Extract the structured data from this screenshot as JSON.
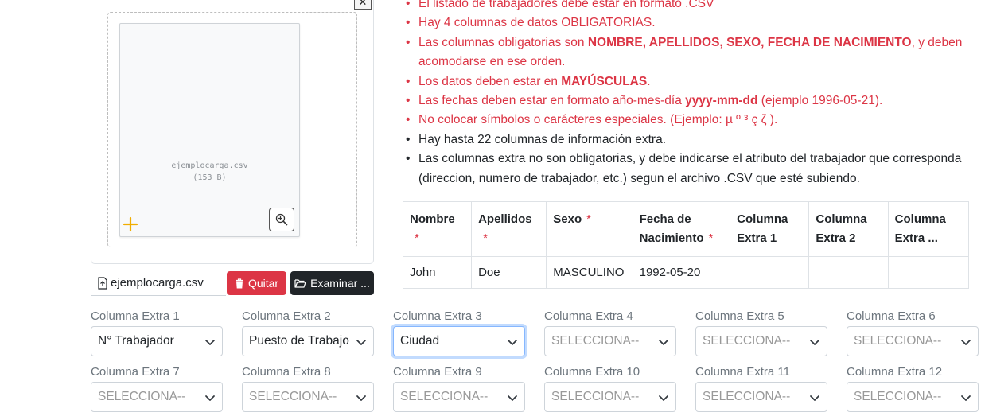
{
  "upload": {
    "close_label": "✕",
    "file_name": "ejemplocarga.csv",
    "file_size": "(153 B)",
    "chip_name": "ejemplocarga.csv",
    "remove_label": "Quitar",
    "browse_label": "Examinar ...",
    "colors": {
      "remove": "#dc3545",
      "browse": "#212529",
      "plus": "#f0ad00"
    }
  },
  "rules": [
    {
      "color": "red",
      "parts": [
        {
          "t": "El listado de trabajadores debe estar en formato .CSV"
        }
      ]
    },
    {
      "color": "red",
      "parts": [
        {
          "t": "Hay 4 columnas de datos OBLIGATORIAS."
        }
      ]
    },
    {
      "color": "red",
      "parts": [
        {
          "t": "Las columnas obligatorias son "
        },
        {
          "t": "NOMBRE, APELLIDOS, SEXO, FECHA DE NACIMIENTO",
          "b": true
        },
        {
          "t": ", y deben acomodarse en ese orden."
        }
      ]
    },
    {
      "color": "red",
      "parts": [
        {
          "t": "Los datos deben estar en "
        },
        {
          "t": "MAYÚSCULAS",
          "b": true
        },
        {
          "t": "."
        }
      ]
    },
    {
      "color": "red",
      "parts": [
        {
          "t": "Las fechas deben estar en formato año-mes-día "
        },
        {
          "t": "yyyy-mm-dd",
          "b": true
        },
        {
          "t": " (ejemplo 1996-05-21)."
        }
      ]
    },
    {
      "color": "red",
      "parts": [
        {
          "t": "No colocar símbolos o carácteres especiales. (Ejemplo: µ º ³ ç ζ )."
        }
      ]
    },
    {
      "color": "black",
      "parts": [
        {
          "t": "Hay hasta 22 columnas de información extra."
        }
      ]
    },
    {
      "color": "black",
      "parts": [
        {
          "t": "Las columnas extra no son obligatorias, y debe indicarse el atributo del trabajador que corresponda (direccion, numero de trabajador, etc.) segun el archivo .CSV que esté subiendo."
        }
      ]
    }
  ],
  "table": {
    "headers": [
      {
        "label": "Nombre",
        "required": true
      },
      {
        "label": "Apellidos",
        "required": true
      },
      {
        "label": "Sexo",
        "required": true
      },
      {
        "label": "Fecha de Nacimiento",
        "required": true
      },
      {
        "label": "Columna Extra 1",
        "required": false
      },
      {
        "label": "Columna Extra 2",
        "required": false
      },
      {
        "label": "Columna Extra ...",
        "required": false
      }
    ],
    "required_mark": "*",
    "row": [
      "John",
      "Doe",
      "MASCULINO",
      "1992-05-20",
      "",
      "",
      ""
    ]
  },
  "extra_columns": [
    {
      "label": "Columna Extra 1",
      "value": "N° Trabajador",
      "placeholder": false,
      "focused": false
    },
    {
      "label": "Columna Extra 2",
      "value": "Puesto de Trabajo",
      "placeholder": false,
      "focused": false
    },
    {
      "label": "Columna Extra 3",
      "value": "Ciudad",
      "placeholder": false,
      "focused": true
    },
    {
      "label": "Columna Extra 4",
      "value": "SELECCIONA--",
      "placeholder": true,
      "focused": false
    },
    {
      "label": "Columna Extra 5",
      "value": "SELECCIONA--",
      "placeholder": true,
      "focused": false
    },
    {
      "label": "Columna Extra 6",
      "value": "SELECCIONA--",
      "placeholder": true,
      "focused": false
    },
    {
      "label": "Columna Extra 7",
      "value": "SELECCIONA--",
      "placeholder": true,
      "focused": false
    },
    {
      "label": "Columna Extra 8",
      "value": "SELECCIONA--",
      "placeholder": true,
      "focused": false
    },
    {
      "label": "Columna Extra 9",
      "value": "SELECCIONA--",
      "placeholder": true,
      "focused": false
    },
    {
      "label": "Columna Extra 10",
      "value": "SELECCIONA--",
      "placeholder": true,
      "focused": false
    },
    {
      "label": "Columna Extra 11",
      "value": "SELECCIONA--",
      "placeholder": true,
      "focused": false
    },
    {
      "label": "Columna Extra 12",
      "value": "SELECCIONA--",
      "placeholder": true,
      "focused": false
    }
  ]
}
